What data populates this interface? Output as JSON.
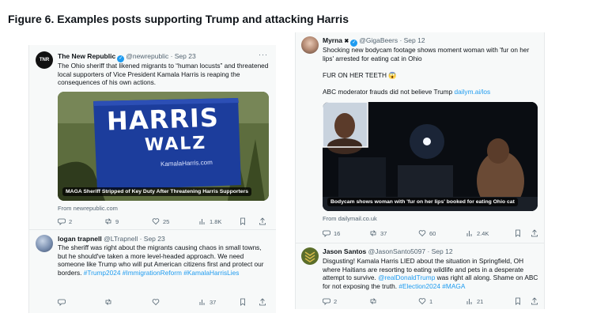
{
  "figure_title": "Figure 6. Examples posts supporting Trump and attacking Harris",
  "left": {
    "tweet1": {
      "avatar_text": "TNR",
      "name": "The New Republic",
      "handle": "@newrepublic · Sep 23",
      "text": "The Ohio sheriff that likened migrants to “human locusts” and threatened local supporters of Vice President Kamala Harris is reaping the consequences of his own actions.",
      "sign_line1": "HARRIS",
      "sign_line2": "WALZ",
      "sign_url": "KamalaHarris.com",
      "card_caption": "MAGA Sheriff Stripped of Key Duty After Threatening Harris Supporters",
      "from": "From newrepublic.com",
      "replies": "2",
      "reposts": "9",
      "likes": "25",
      "views": "1.8K"
    },
    "tweet2": {
      "name": "logan trapnell",
      "handle": "@LTrapnell · Sep 23",
      "text": "The sheriff was right about the migrants causing chaos in small towns, but he should've taken a more level-headed approach. We need someone like Trump who will put American citizens first and protect our borders.",
      "hashtags": "#Trump2024 #ImmigrationReform #KamalaHarrisLies",
      "replies": "",
      "reposts": "",
      "likes": "",
      "views": "37"
    }
  },
  "right": {
    "tweet1": {
      "name": "Myrna",
      "name_suffix": "✖",
      "handle": "@GigaBeers · Sep 12",
      "text": "Shocking new bodycam footage shows moment woman with 'fur on her lips' arrested for eating cat in Ohio",
      "emphasis": "FUR ON HER TEETH 😱",
      "line3_prefix": "ABC moderator frauds did not believe Trump",
      "line3_link": "dailym.ai/los",
      "card_caption": "Bodycam shows woman with 'fur on her lips' booked for eating Ohio cat",
      "from": "From dailymail.co.uk",
      "replies": "16",
      "reposts": "37",
      "likes": "60",
      "views": "2.4K"
    },
    "tweet2": {
      "name": "Jason Santos",
      "handle": "@JasonSanto5097 · Sep 12",
      "text_a": "Disgusting! Kamala Harris LIED about the situation in Springfield, OH where Haitians are resorting to eating wildlife and pets in a desperate attempt to survive.",
      "mention": "@realDonaldTrump",
      "text_b": "was right all along. Shame on ABC for not exposing the truth.",
      "hashtags": "#Election2024 #MAGA",
      "replies": "2",
      "reposts": "",
      "likes": "1",
      "views": "21"
    }
  }
}
